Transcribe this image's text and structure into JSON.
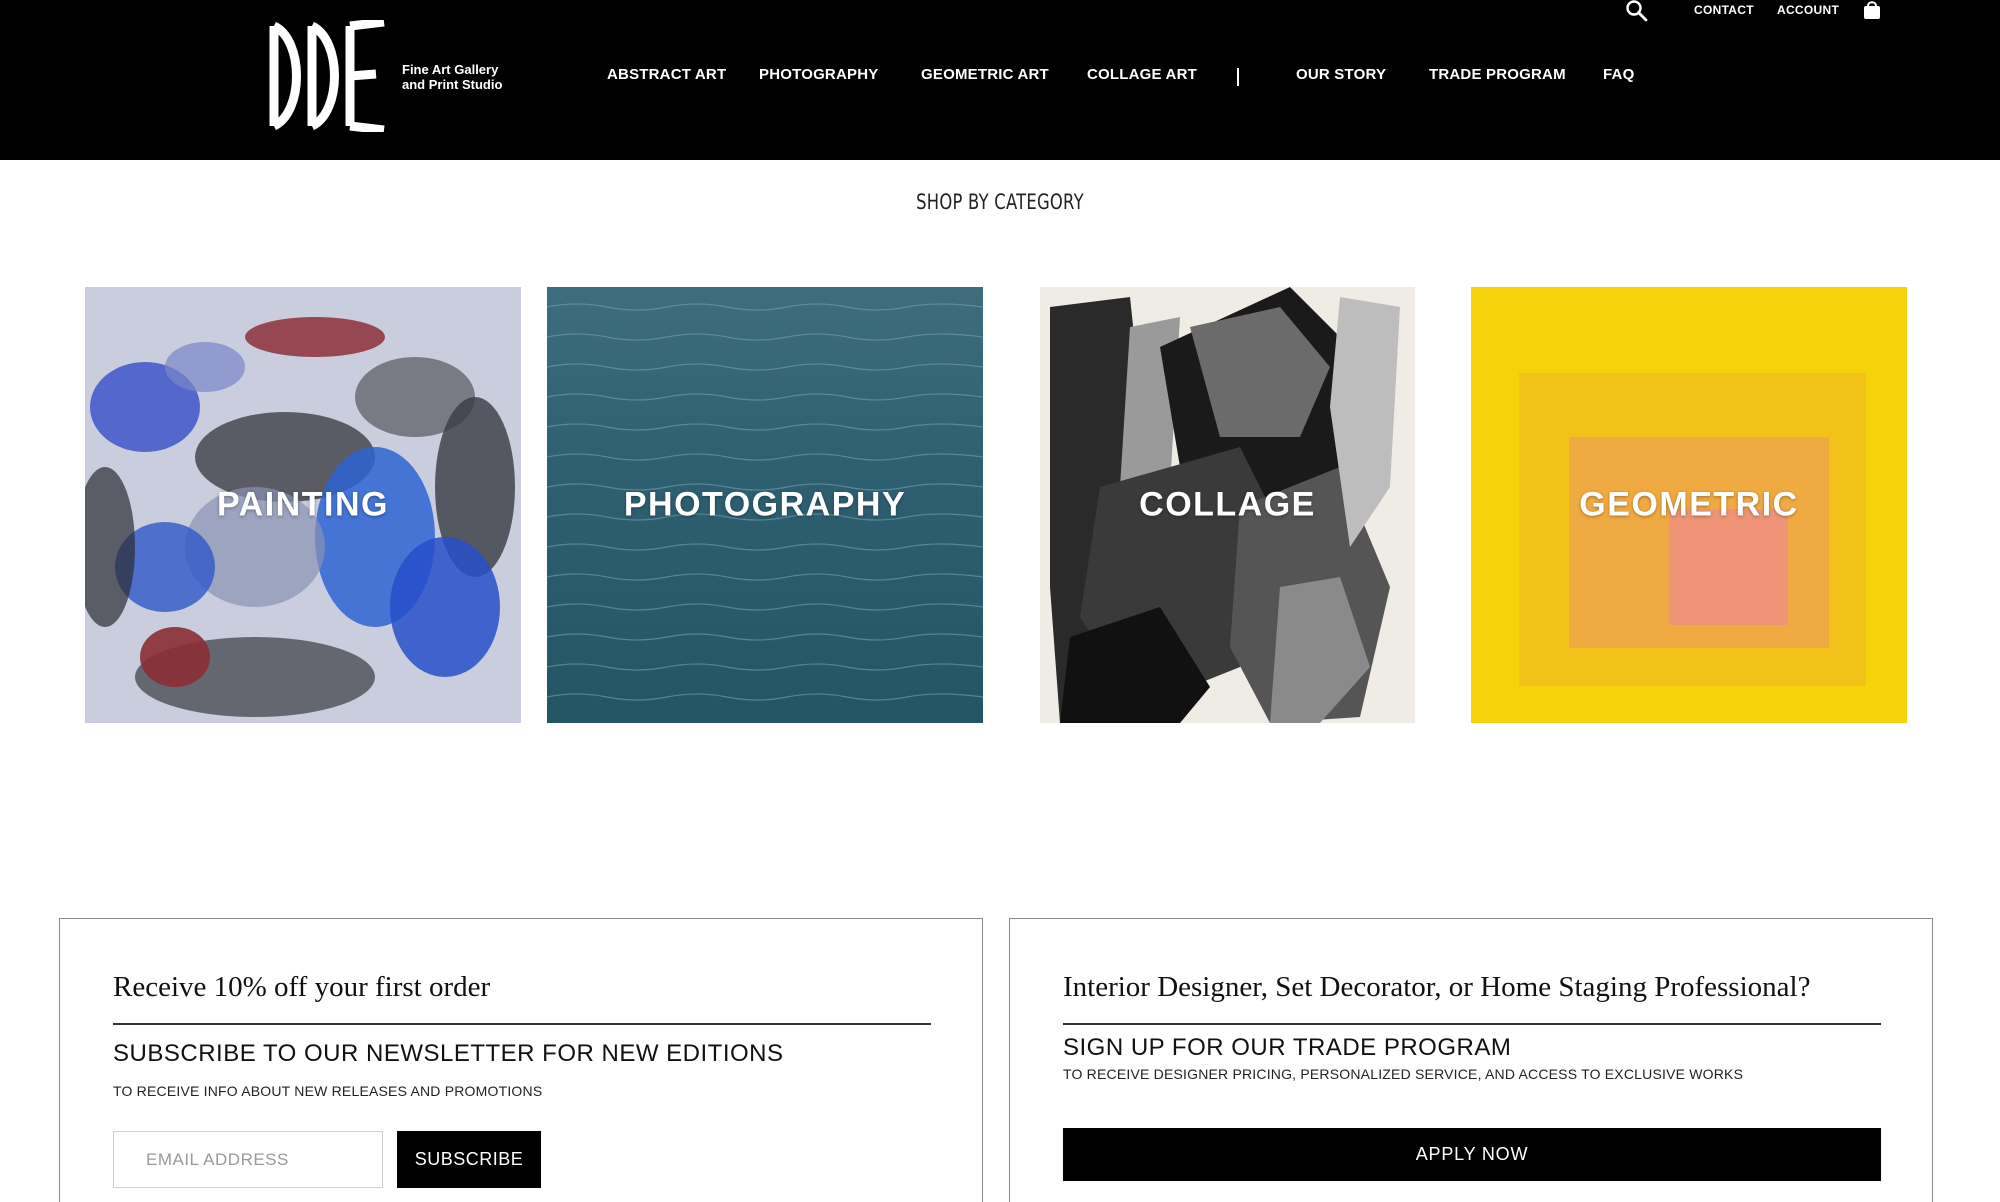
{
  "brand": {
    "tagline_line1": "Fine Art Gallery",
    "tagline_line2": "and Print Studio"
  },
  "utility": {
    "contact": "CONTACT",
    "account": "ACCOUNT"
  },
  "nav": {
    "items": [
      {
        "label": "ABSTRACT ART"
      },
      {
        "label": "PHOTOGRAPHY"
      },
      {
        "label": "GEOMETRIC ART"
      },
      {
        "label": "COLLAGE ART"
      },
      {
        "label": "OUR STORY"
      },
      {
        "label": "TRADE PROGRAM"
      },
      {
        "label": "FAQ"
      }
    ]
  },
  "shop": {
    "title": "SHOP BY CATEGORY",
    "categories": [
      {
        "label": "PAINTING"
      },
      {
        "label": "PHOTOGRAPHY"
      },
      {
        "label": "COLLAGE"
      },
      {
        "label": "GEOMETRIC"
      }
    ]
  },
  "newsletter": {
    "heading": "Receive 10% off your first order",
    "subheading": "SUBSCRIBE TO OUR NEWSLETTER FOR NEW EDITIONS",
    "note": "TO RECEIVE INFO ABOUT NEW RELEASES AND PROMOTIONS",
    "email_placeholder": "EMAIL ADDRESS",
    "button": "SUBSCRIBE"
  },
  "trade": {
    "heading": "Interior Designer, Set Decorator, or Home Staging Professional?",
    "subheading": "SIGN UP FOR OUR TRADE PROGRAM",
    "note": "TO RECEIVE DESIGNER PRICING, PERSONALIZED SERVICE, AND ACCESS TO EXCLUSIVE WORKS",
    "button": "APPLY NOW"
  },
  "colors": {
    "header_bg": "#000000",
    "geometric_yellow": "#f6d20a"
  }
}
